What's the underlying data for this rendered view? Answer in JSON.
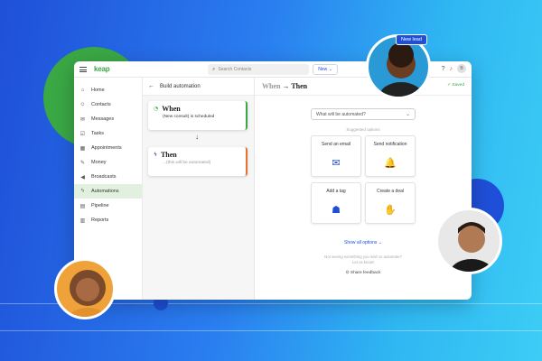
{
  "topbar": {
    "logo": "keap",
    "search_placeholder": "Search Contacts",
    "new_label": "New ⌄",
    "avatar_initial": "B"
  },
  "sidebar": {
    "items": [
      {
        "label": "Home",
        "icon": "home-icon",
        "glyph": "⌂"
      },
      {
        "label": "Contacts",
        "icon": "contacts-icon",
        "glyph": "☺"
      },
      {
        "label": "Messages",
        "icon": "messages-icon",
        "glyph": "✉"
      },
      {
        "label": "Tasks",
        "icon": "tasks-icon",
        "glyph": "☑"
      },
      {
        "label": "Appointments",
        "icon": "calendar-icon",
        "glyph": "▦"
      },
      {
        "label": "Money",
        "icon": "money-icon",
        "glyph": "✎"
      },
      {
        "label": "Broadcasts",
        "icon": "broadcast-icon",
        "glyph": "◀"
      },
      {
        "label": "Automations",
        "icon": "automation-icon",
        "glyph": "ϟ",
        "active": true
      },
      {
        "label": "Pipeline",
        "icon": "pipeline-icon",
        "glyph": "▤"
      },
      {
        "label": "Reports",
        "icon": "reports-icon",
        "glyph": "▥"
      }
    ]
  },
  "build": {
    "title": "Build automation",
    "when": {
      "title": "When",
      "subtitle": "(New consult) is scheduled"
    },
    "then": {
      "title": "Then",
      "subtitle": "...(this will be automated)"
    }
  },
  "main": {
    "title_when": "When",
    "title_arrow": "→",
    "title_then": "Then",
    "saved": "Saved",
    "dropdown_placeholder": "What will be automated?",
    "suggested": "Suggested options",
    "options": [
      {
        "label": "Send an email",
        "icon": "email-icon",
        "glyph": "✉"
      },
      {
        "label": "Send notification",
        "icon": "bell-icon",
        "glyph": "🔔"
      },
      {
        "label": "Add a tag",
        "icon": "tag-icon",
        "glyph": "☗"
      },
      {
        "label": "Create a deal",
        "icon": "handshake-icon",
        "glyph": "✋"
      }
    ],
    "show_all": "Show all options ⌄",
    "not_seeing_line1": "Not seeing something you wish to automate?",
    "not_seeing_line2": "Let us know!",
    "feedback": "Share feedback"
  },
  "overlay": {
    "badge": "New lead"
  },
  "colors": {
    "brand_green": "#3aa845",
    "brand_blue": "#1f4fd8",
    "then_accent": "#e8712d"
  }
}
